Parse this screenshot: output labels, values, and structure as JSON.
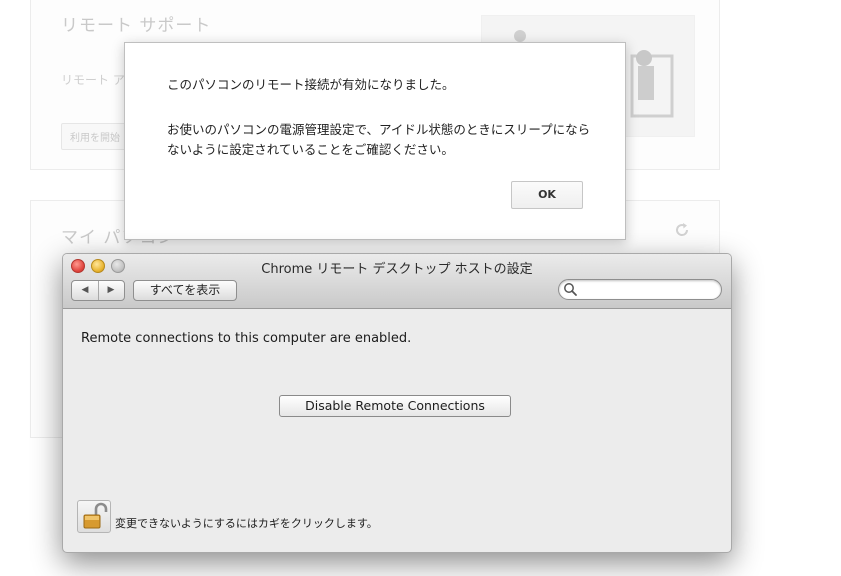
{
  "background_page": {
    "section1_title": "リモート サポート",
    "section1_desc": "リモート ア",
    "section1_button": "利用を開始",
    "section2_title": "マイ パソコン"
  },
  "alert": {
    "message_line1": "このパソコンのリモート接続が有効になりました。",
    "message_line2": "お使いのパソコンの電源管理設定で、アイドル状態のときにスリープにならないように設定されていることをご確認ください。",
    "ok_label": "OK"
  },
  "prefs_window": {
    "title": "Chrome リモート デスクトップ ホストの設定",
    "back_label": "◀",
    "forward_label": "▶",
    "show_all_label": "すべてを表示",
    "search_placeholder": "",
    "status_message": "Remote connections to this computer are enabled.",
    "disable_button_label": "Disable Remote Connections",
    "lock_message": "変更できないようにするにはカギをクリックします。"
  },
  "colors": {
    "close_light": "#e0443e",
    "minimize_light": "#e8b32e",
    "maximize_light": "#c2c2c2",
    "window_bg": "#ececec"
  },
  "icons": [
    "refresh-icon",
    "search-icon",
    "padlock-open-icon",
    "person-at-computer-illustration"
  ]
}
